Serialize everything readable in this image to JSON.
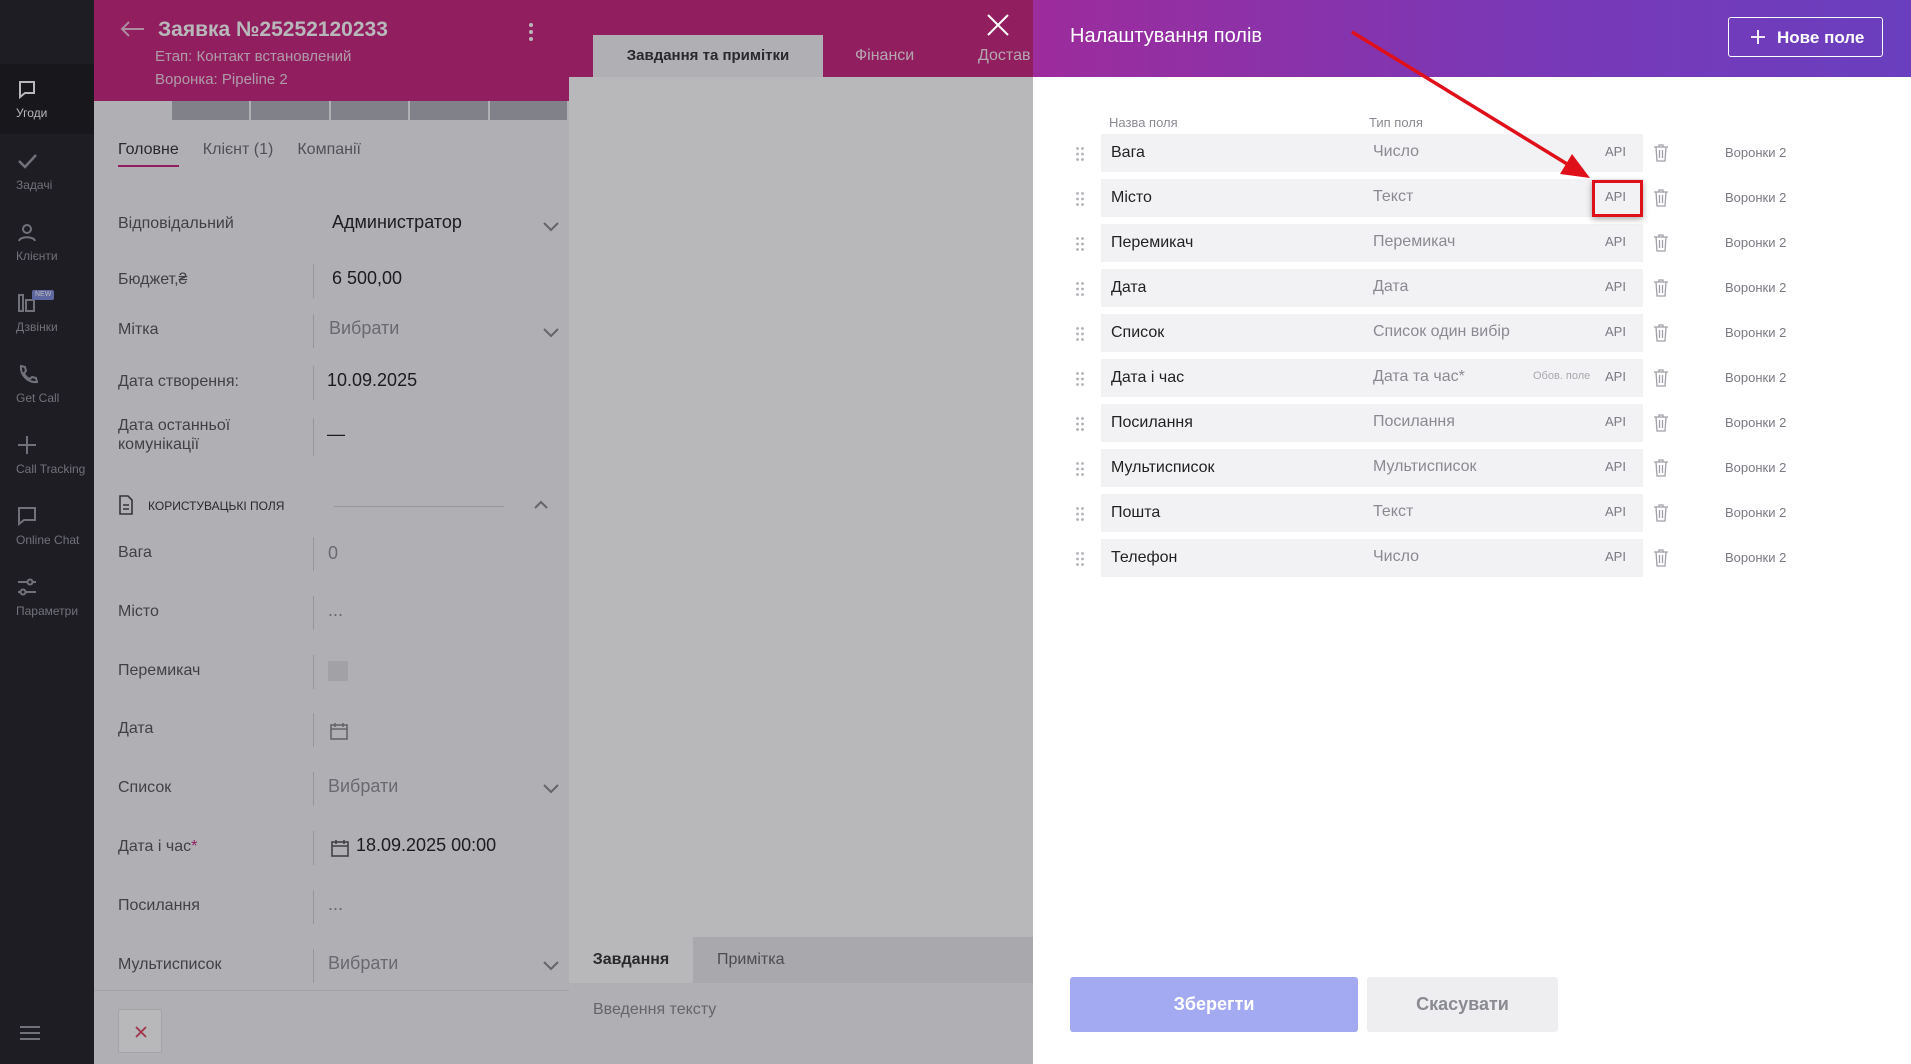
{
  "sidebar": {
    "items": [
      {
        "label": "Угоди",
        "icon": "deals-icon"
      },
      {
        "label": "Задачі",
        "icon": "check-icon"
      },
      {
        "label": "Клієнти",
        "icon": "user-icon"
      },
      {
        "label": "Дзвінки",
        "icon": "calls-icon",
        "badge": "NEW"
      },
      {
        "label": "Get Call",
        "icon": "phone-icon"
      },
      {
        "label": "Call Tracking",
        "icon": "tracking-icon"
      },
      {
        "label": "Online Chat",
        "icon": "chat-icon"
      },
      {
        "label": "Параметри",
        "icon": "sliders-icon"
      }
    ]
  },
  "deal": {
    "title": "Заявка №25252120233",
    "stage": "Етап: Контакт встановлений",
    "funnel": "Воронка: Pipeline 2",
    "tabs": [
      "Головне",
      "Клієнт (1)",
      "Компанії"
    ],
    "fields": {
      "responsible_label": "Відповідальний",
      "responsible_value": "Администратор",
      "budget_label": "Бюджет,₴",
      "budget_value": "6 500,00",
      "tag_label": "Мітка",
      "tag_value": "Вибрати",
      "created_label": "Дата створення:",
      "created_value": "10.09.2025",
      "last_comm_label": "Дата останньої комунікації",
      "last_comm_value": "—"
    },
    "custom_section_label": "КОРИСТУВАЦЬКІ ПОЛЯ",
    "custom_fields": {
      "weight_label": "Вага",
      "weight_value": "0",
      "city_label": "Місто",
      "city_value": "...",
      "switch_label": "Перемикач",
      "date_label": "Дата",
      "list_label": "Список",
      "list_value": "Вибрати",
      "datetime_label": "Дата і час",
      "datetime_required": "*",
      "datetime_value": "18.09.2025 00:00",
      "link_label": "Посилання",
      "link_value": "...",
      "multilist_label": "Мультисписок",
      "multilist_value": "Вибрати"
    }
  },
  "middle": {
    "tabs": [
      "Завдання та примітки",
      "Фінанси",
      "Достав"
    ],
    "bottom_tabs": [
      "Завдання",
      "Примітка"
    ],
    "input_placeholder": "Введення тексту"
  },
  "settings": {
    "title": "Налаштування полів",
    "new_field_label": "Нове поле",
    "col_name": "Назва поля",
    "col_type": "Тип поля",
    "fields": [
      {
        "name": "Вага",
        "type": "Число",
        "note": "",
        "api": "API",
        "funnel": "Воронки 2"
      },
      {
        "name": "Місто",
        "type": "Текст",
        "note": "",
        "api": "API",
        "funnel": "Воронки 2"
      },
      {
        "name": "Перемикач",
        "type": "Перемикач",
        "note": "",
        "api": "API",
        "funnel": "Воронки 2"
      },
      {
        "name": "Дата",
        "type": "Дата",
        "note": "",
        "api": "API",
        "funnel": "Воронки 2"
      },
      {
        "name": "Список",
        "type": "Список один вибір",
        "note": "",
        "api": "API",
        "funnel": "Воронки 2"
      },
      {
        "name": "Дата і час",
        "type": "Дата та час*",
        "note": "Обов. поле",
        "api": "API",
        "funnel": "Воронки 2"
      },
      {
        "name": "Посилання",
        "type": "Посилання",
        "note": "",
        "api": "API",
        "funnel": "Воронки 2"
      },
      {
        "name": "Мультисписок",
        "type": "Мультисписок",
        "note": "",
        "api": "API",
        "funnel": "Воронки 2"
      },
      {
        "name": "Пошта",
        "type": "Текст",
        "note": "",
        "api": "API",
        "funnel": "Воронки 2"
      },
      {
        "name": "Телефон",
        "type": "Число",
        "note": "",
        "api": "API",
        "funnel": "Воронки 2"
      }
    ],
    "save_label": "Зберегти",
    "cancel_label": "Скасувати"
  },
  "colors": {
    "brand_magenta": "#c8247f",
    "header_purple": "#7a38b6",
    "save_button": "#a3aaf2",
    "highlight_red": "#e0101a"
  }
}
